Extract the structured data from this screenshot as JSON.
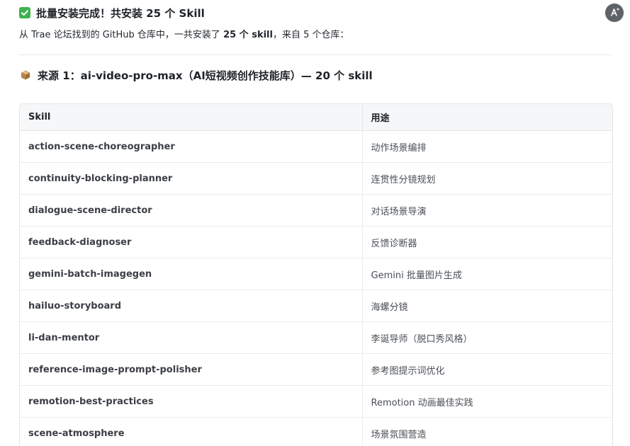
{
  "header": {
    "title": "批量安装完成！共安装 25 个 Skill",
    "icons": {
      "status": "check-icon",
      "assistant": "assistant-icon"
    }
  },
  "intro": {
    "prefix": "从 Trae 论坛找到的 GitHub 仓库中，一共安装了 ",
    "count_text": "25 个 skill",
    "suffix": "，来自 5 个仓库："
  },
  "section": {
    "icon": "package-icon",
    "title": "来源 1：ai-video-pro-max（AI短视频创作技能库）— 20 个 skill"
  },
  "table": {
    "headers": [
      "Skill",
      "用途"
    ],
    "rows": [
      {
        "skill": "action-scene-choreographer",
        "purpose": "动作场景编排"
      },
      {
        "skill": "continuity-blocking-planner",
        "purpose": "连贯性分镜规划"
      },
      {
        "skill": "dialogue-scene-director",
        "purpose": "对话场景导演"
      },
      {
        "skill": "feedback-diagnoser",
        "purpose": "反馈诊断器"
      },
      {
        "skill": "gemini-batch-imagegen",
        "purpose": "Gemini 批量图片生成"
      },
      {
        "skill": "hailuo-storyboard",
        "purpose": "海螺分镜"
      },
      {
        "skill": "li-dan-mentor",
        "purpose": "李诞导师（脱口秀风格）"
      },
      {
        "skill": "reference-image-prompt-polisher",
        "purpose": "参考图提示词优化"
      },
      {
        "skill": "remotion-best-practices",
        "purpose": "Remotion 动画最佳实践"
      },
      {
        "skill": "scene-atmosphere",
        "purpose": "场景氛围营造"
      }
    ]
  },
  "colors": {
    "check": "#3fb24f",
    "assistant_bg": "#5f6368",
    "header_bg": "#f6f7f8",
    "border": "#e3e5e8"
  }
}
